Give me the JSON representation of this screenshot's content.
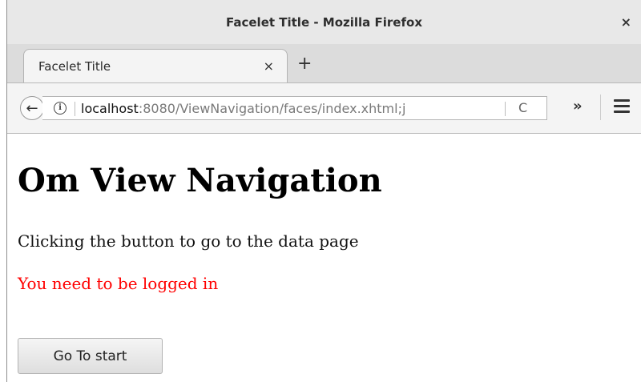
{
  "window": {
    "title": "Facelet Title - Mozilla Firefox",
    "close_glyph": "×"
  },
  "tabs": [
    {
      "title": "Facelet Title",
      "close_glyph": "×"
    }
  ],
  "new_tab_glyph": "+",
  "navbar": {
    "back_glyph": "←",
    "info_glyph": "i",
    "url_host": "localhost",
    "url_rest": ":8080/ViewNavigation/faces/index.xhtml;j",
    "reload_glyph": "C",
    "overflow_glyph": "»"
  },
  "icons": {
    "back": "back-arrow-icon",
    "info": "info-icon",
    "reload": "reload-icon",
    "overflow": "chevron-double-right-icon",
    "menu": "hamburger-menu-icon"
  },
  "page": {
    "heading": "Om View Navigation",
    "text": "Clicking the button to go to the data page",
    "error": "You need to be logged in",
    "button_label": "Go To start"
  },
  "colors": {
    "error": "#ff0000"
  }
}
